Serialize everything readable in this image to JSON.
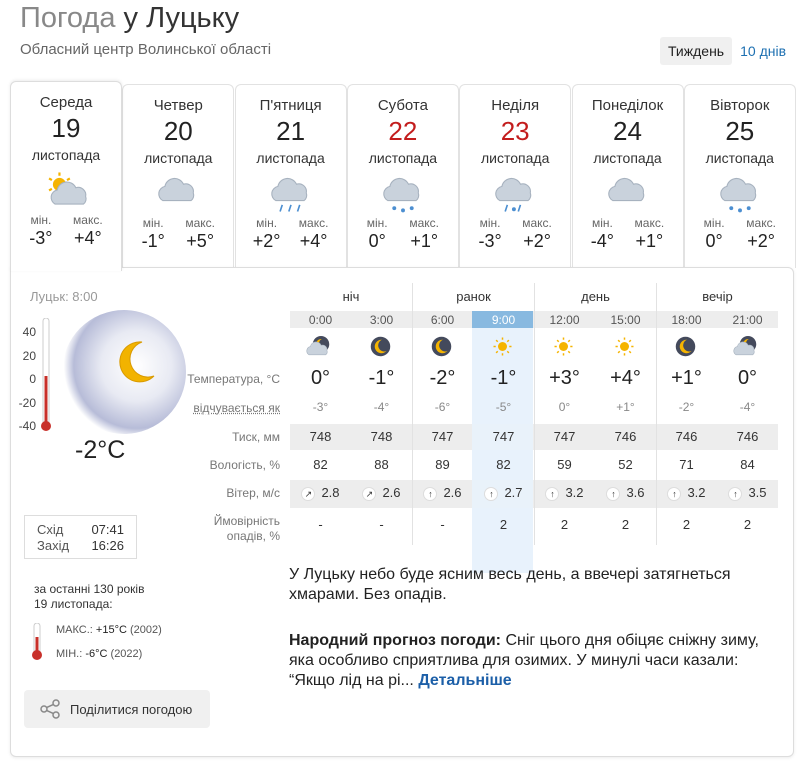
{
  "header": {
    "title_prefix": "Погода",
    "title_city": "у Луцьку",
    "subtitle": "Обласний центр Волинської області"
  },
  "view": {
    "week_label": "Тиждень",
    "ten_days_label": "10 днів"
  },
  "days": [
    {
      "name": "Середа",
      "date": "19",
      "month": "листопада",
      "icon": "partly-cloudy-sun-icon",
      "min_label": "мін.",
      "max_label": "макс.",
      "min": "-3°",
      "max": "+4°",
      "red": false
    },
    {
      "name": "Четвер",
      "date": "20",
      "month": "листопада",
      "icon": "cloudy-icon",
      "min_label": "мін.",
      "max_label": "макс.",
      "min": "-1°",
      "max": "+5°",
      "red": false
    },
    {
      "name": "П'ятниця",
      "date": "21",
      "month": "листопада",
      "icon": "rain-cloud-icon",
      "min_label": "мін.",
      "max_label": "макс.",
      "min": "+2°",
      "max": "+4°",
      "red": false
    },
    {
      "name": "Субота",
      "date": "22",
      "month": "листопада",
      "icon": "snow-cloud-icon",
      "min_label": "мін.",
      "max_label": "макс.",
      "min": "0°",
      "max": "+1°",
      "red": true
    },
    {
      "name": "Неділя",
      "date": "23",
      "month": "листопада",
      "icon": "sleet-cloud-icon",
      "min_label": "мін.",
      "max_label": "макс.",
      "min": "-3°",
      "max": "+2°",
      "red": true
    },
    {
      "name": "Понеділок",
      "date": "24",
      "month": "листопада",
      "icon": "cloudy-icon",
      "min_label": "мін.",
      "max_label": "макс.",
      "min": "-4°",
      "max": "+1°",
      "red": false
    },
    {
      "name": "Вівторок",
      "date": "25",
      "month": "листопада",
      "icon": "snow-cloud-icon",
      "min_label": "мін.",
      "max_label": "макс.",
      "min": "0°",
      "max": "+2°",
      "red": false
    }
  ],
  "current": {
    "label": "Луцьк: 8:00",
    "scale": [
      "40",
      "20",
      "0",
      "-20",
      "-40"
    ],
    "temp": "-2°C",
    "icon": "moon-icon",
    "sunrise_label": "Схід",
    "sunrise": "07:41",
    "sunset_label": "Захід",
    "sunset": "16:26"
  },
  "history": {
    "line1": "за останні 130 років",
    "line2": "19 листопада:",
    "max_label": "МАКС.:",
    "max_value": "+15°C",
    "max_year": "(2002)",
    "min_label": "МІН.:",
    "min_value": "-6°C",
    "min_year": "(2022)"
  },
  "share_label": "Поділитися погодою",
  "periods": [
    "ніч",
    "ранок",
    "день",
    "вечір"
  ],
  "row_labels": {
    "temp": "Температура, °C",
    "feels": "відчувається як",
    "pressure": "Тиск, мм",
    "humidity": "Вологість, %",
    "wind": "Вітер, м/с",
    "precip_1": "Ймовірність",
    "precip_2": "опадів, %"
  },
  "hours": [
    {
      "time": "0:00",
      "icon": "cloudy-night-icon",
      "temp": "0°",
      "feels": "-3°",
      "pressure": "748",
      "humidity": "82",
      "wind_dir": "↗",
      "wind": "2.8",
      "precip": "-"
    },
    {
      "time": "3:00",
      "icon": "clear-night-icon",
      "temp": "-1°",
      "feels": "-4°",
      "pressure": "748",
      "humidity": "88",
      "wind_dir": "↗",
      "wind": "2.6",
      "precip": "-"
    },
    {
      "time": "6:00",
      "icon": "clear-night-icon",
      "temp": "-2°",
      "feels": "-6°",
      "pressure": "747",
      "humidity": "89",
      "wind_dir": "↑",
      "wind": "2.6",
      "precip": "-"
    },
    {
      "time": "9:00",
      "icon": "sun-icon",
      "temp": "-1°",
      "feels": "-5°",
      "pressure": "747",
      "humidity": "82",
      "wind_dir": "↑",
      "wind": "2.7",
      "precip": "2"
    },
    {
      "time": "12:00",
      "icon": "sun-icon",
      "temp": "+3°",
      "feels": "0°",
      "pressure": "747",
      "humidity": "59",
      "wind_dir": "↑",
      "wind": "3.2",
      "precip": "2"
    },
    {
      "time": "15:00",
      "icon": "sun-icon",
      "temp": "+4°",
      "feels": "+1°",
      "pressure": "746",
      "humidity": "52",
      "wind_dir": "↑",
      "wind": "3.6",
      "precip": "2"
    },
    {
      "time": "18:00",
      "icon": "clear-night-icon",
      "temp": "+1°",
      "feels": "-2°",
      "pressure": "746",
      "humidity": "71",
      "wind_dir": "↑",
      "wind": "3.2",
      "precip": "2"
    },
    {
      "time": "21:00",
      "icon": "cloudy-night-icon",
      "temp": "0°",
      "feels": "-4°",
      "pressure": "746",
      "humidity": "84",
      "wind_dir": "↑",
      "wind": "3.5",
      "precip": "2"
    }
  ],
  "description": "У Луцьку небо буде ясним весь день, а ввечері затягнеться хмарами. Без опадів.",
  "folk": {
    "title": "Народний прогноз погоди:",
    "text": "Сніг цього дня обіцяє сніжну зиму, яка особливо сприятлива для озимих. У минулі часи казали: “Якщо лід на рі...",
    "more": "Детальніше"
  }
}
